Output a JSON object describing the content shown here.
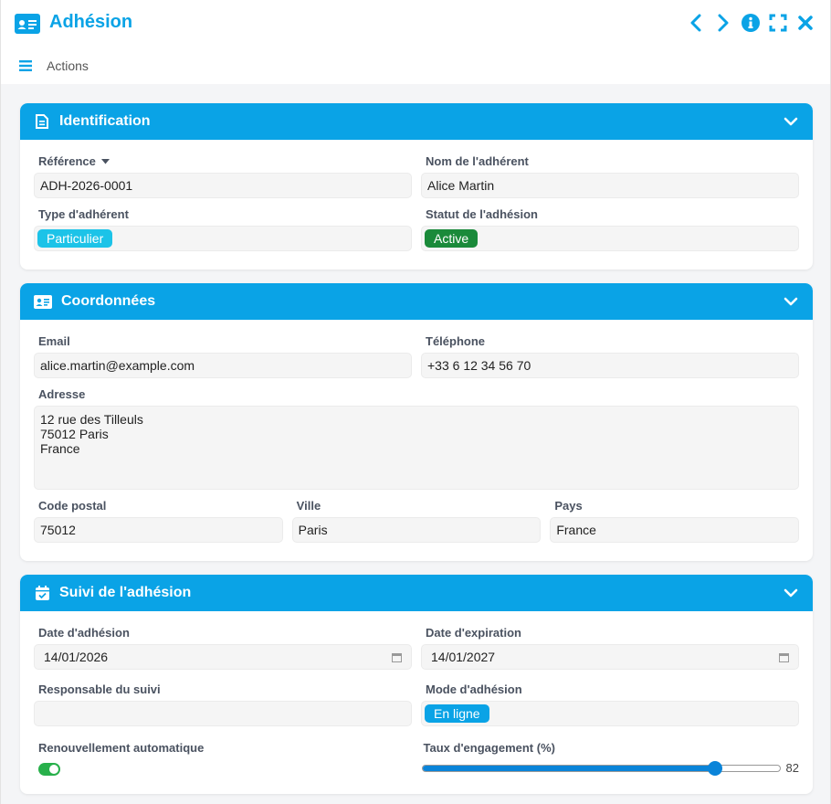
{
  "app": {
    "title": "Adhésion",
    "accent": "#0aa3e6",
    "icons": [
      "id-card-icon",
      "chevron-left-icon",
      "chevron-right-icon",
      "info-icon",
      "fullscreen-icon",
      "close-icon"
    ]
  },
  "toolbar": {
    "actions_label": "Actions"
  },
  "sections": {
    "identification": {
      "title": "Identification",
      "reference": {
        "label": "Référence",
        "value": "ADH-2026-0001"
      },
      "nom": {
        "label": "Nom de l'adhérent",
        "value": "Alice Martin"
      },
      "type": {
        "label": "Type d'adhérent",
        "value": "Particulier",
        "color": "#1cc3e8"
      },
      "statut": {
        "label": "Statut de l'adhésion",
        "value": "Active",
        "color": "#1a8a3a"
      }
    },
    "coordonnees": {
      "title": "Coordonnées",
      "email": {
        "label": "Email",
        "value": "alice.martin@example.com"
      },
      "telephone": {
        "label": "Téléphone",
        "value": "+33 6 12 34 56 70"
      },
      "adresse": {
        "label": "Adresse",
        "value": "12 rue des Tilleuls\n75012 Paris\nFrance"
      },
      "code_postal": {
        "label": "Code postal",
        "value": "75012"
      },
      "ville": {
        "label": "Ville",
        "value": "Paris"
      },
      "pays": {
        "label": "Pays",
        "value": "France"
      }
    },
    "suivi": {
      "title": "Suivi de l'adhésion",
      "date_adhesion": {
        "label": "Date d'adhésion",
        "value": "14/01/2026"
      },
      "date_expiration": {
        "label": "Date d'expiration",
        "value": "14/01/2027"
      },
      "responsable": {
        "label": "Responsable du suivi",
        "value": ""
      },
      "mode": {
        "label": "Mode d'adhésion",
        "value": "En ligne",
        "color": "#0aa3e6"
      },
      "renouvellement": {
        "label": "Renouvellement automatique",
        "checked": true
      },
      "engagement": {
        "label": "Taux d'engagement (%)",
        "value": 82,
        "display": "82"
      }
    }
  }
}
